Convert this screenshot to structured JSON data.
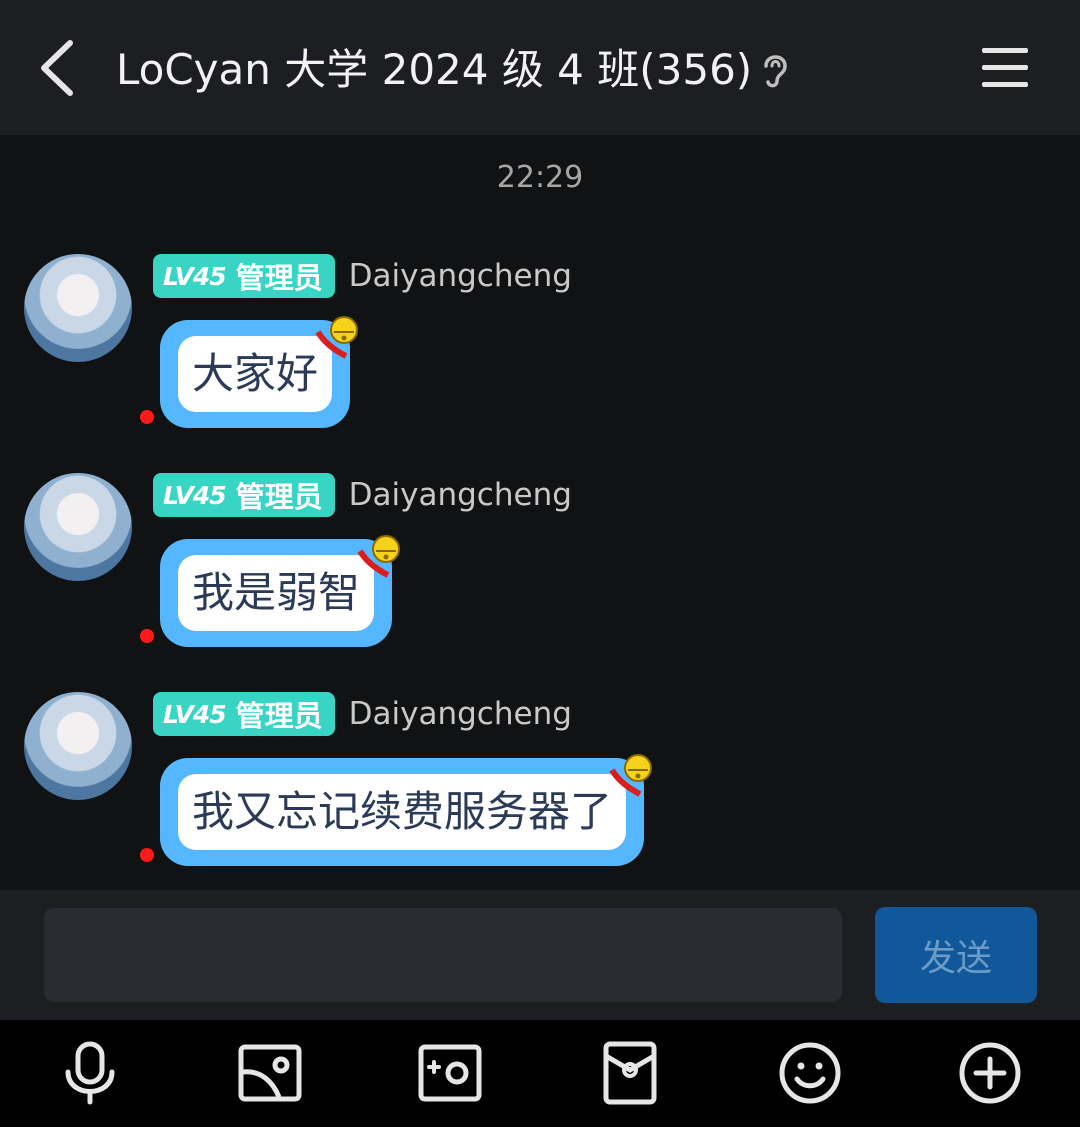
{
  "header": {
    "title": "LoCyan 大学 2024 级 4 班(356)",
    "icons": [
      "back-arrow-icon",
      "ear-icon",
      "menu-icon"
    ]
  },
  "chat": {
    "timestamp": "22:29",
    "messages": [
      {
        "level": "LV45",
        "role": "管理员",
        "sender": "Daiyangcheng",
        "text": "大家好"
      },
      {
        "level": "LV45",
        "role": "管理员",
        "sender": "Daiyangcheng",
        "text": "我是弱智"
      },
      {
        "level": "LV45",
        "role": "管理员",
        "sender": "Daiyangcheng",
        "text": "我又忘记续费服务器了"
      }
    ]
  },
  "composer": {
    "input_value": "",
    "send_label": "发送"
  },
  "toolbar": {
    "icons": [
      "microphone-icon",
      "image-icon",
      "camera-icon",
      "red-packet-icon",
      "emoji-icon",
      "plus-icon"
    ]
  },
  "colors": {
    "badge": "#39d5c4",
    "bubble_border": "#55b7ff",
    "send_button": "#11589b",
    "unread_dot": "#ff1a1a"
  }
}
